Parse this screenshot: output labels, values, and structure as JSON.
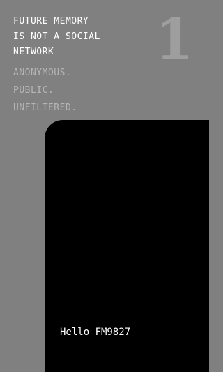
{
  "header": {
    "headline_lines": [
      "FUTURE MEMORY",
      "IS NOT A SOCIAL",
      "NETWORK"
    ],
    "tagline_lines": [
      "ANONYMOUS.",
      "PUBLIC.",
      "UNFILTERED."
    ],
    "page_number": "1"
  },
  "terminal": {
    "greeting": "Hello FM9827"
  },
  "colors": {
    "background": "#808080",
    "panel": "#000000",
    "headline_text": "#ffffff",
    "tagline_text": "#b5b5b5",
    "page_number": "#9e9e9e"
  }
}
